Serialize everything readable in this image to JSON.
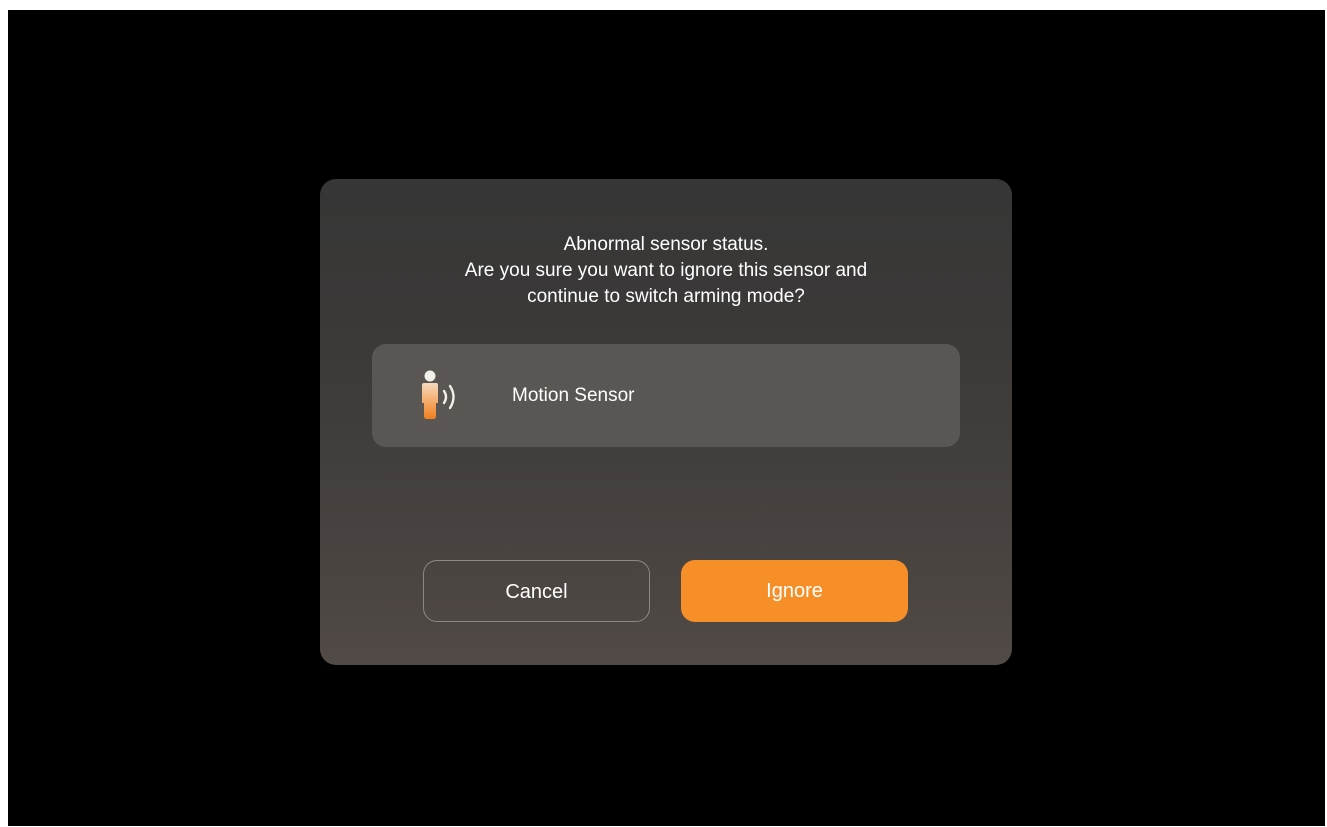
{
  "dialog": {
    "message_lines": [
      "Abnormal sensor status.",
      "Are you sure you want to ignore this sensor and",
      "continue to switch arming mode?"
    ],
    "sensor": {
      "icon": "motion-sensor-icon",
      "name": "Motion Sensor"
    },
    "buttons": {
      "cancel_label": "Cancel",
      "ignore_label": "Ignore"
    },
    "colors": {
      "accent": "#f78f29",
      "background": "#000000"
    }
  }
}
